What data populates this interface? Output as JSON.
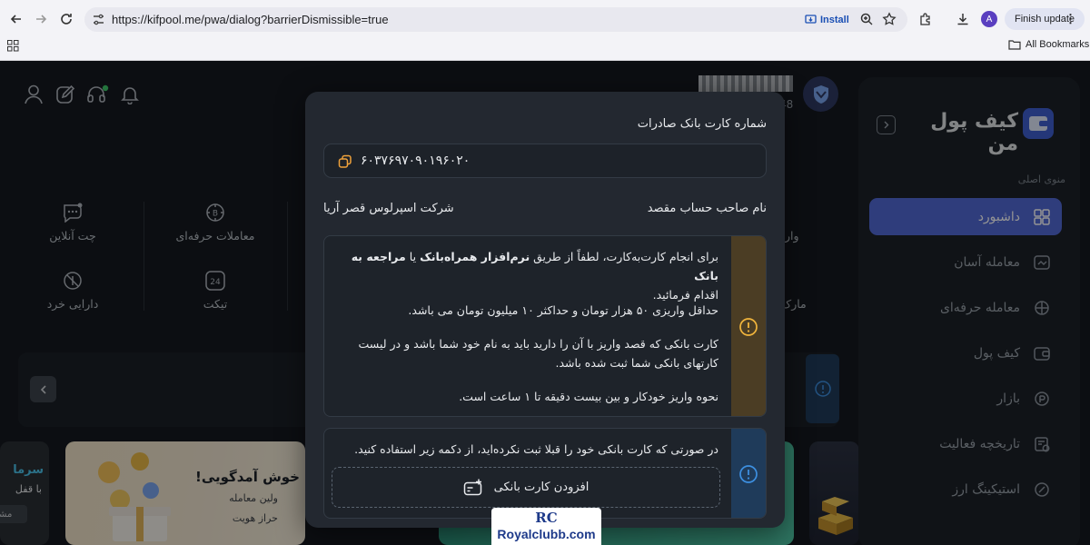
{
  "browser": {
    "url": "https://kifpool.me/pwa/dialog?barrierDismissible=true",
    "install_label": "Install",
    "profile_initial": "A",
    "finish_update_label": "Finish update",
    "bookmarks_label": "All Bookmarks"
  },
  "header": {
    "masked_name_suffix": "48"
  },
  "app": {
    "logo_text": "کیف پول من",
    "menu_heading": "منوی اصلی",
    "nav": [
      {
        "label": "داشبورد",
        "icon": "dashboard-icon",
        "active": true
      },
      {
        "label": "معامله آسان",
        "icon": "easy-trade-icon",
        "active": false
      },
      {
        "label": "معامله حرفه‌ای",
        "icon": "pro-trade-icon",
        "active": false
      },
      {
        "label": "کیف پول",
        "icon": "wallet-icon",
        "active": false
      },
      {
        "label": "بازار",
        "icon": "market-icon",
        "active": false
      },
      {
        "label": "تاریخچه فعالیت",
        "icon": "history-icon",
        "active": false
      },
      {
        "label": "استیکینگ ارز",
        "icon": "staking-icon",
        "active": false
      }
    ],
    "actions": {
      "chat": "چت آنلاین",
      "pro_trades": "معاملات حرفه‌ای",
      "assets": "دارایی خرد",
      "ticket": "تیکت",
      "partial_left_1": "وار",
      "partial_left_2": "مارک"
    },
    "banner_welcome": {
      "title": "خوش آمدگویی!",
      "line1": "ولین معامله",
      "line2": "حراز هویت"
    },
    "banner_left": {
      "title": "سرما",
      "line1": "با قفل",
      "button": "مشا"
    }
  },
  "dialog": {
    "card_title": "شماره کارت بانک صادرات",
    "card_number": "۶۰۳۷۶۹۷۰۹۰۱۹۶۰۲۰",
    "owner_label": "نام صاحب حساب مقصد",
    "owner_value": "شرکت اسپرلوس قصر آریا",
    "warning": {
      "p1_lead": "برای انجام کارت‌به‌کارت، لطفاً از طریق",
      "p1_bold1": "نرم‌افزار همراه‌بانک",
      "p1_mid": "یا",
      "p1_bold2": "مراجعه به بانک",
      "p1_tail": "اقدام فرمائید.",
      "p2": "حداقل واریزی ۵۰ هزار تومان و حداکثر ۱۰ میلیون تومان می باشد.",
      "p3": "کارت بانکی که قصد واریز با آن را دارید باید به نام خود شما باشد و در لیست کارتهای بانکی شما ثبت شده باشد.",
      "p4": "نحوه واریز خودکار و بین بیست دقیقه تا ۱ ساعت است."
    },
    "info": {
      "text": "در صورتی که کارت بانکی خود را قبلا ثبت نکرده‌اید، از دکمه زیر استفاده کنید.",
      "add_card_label": "افزودن کارت بانکی"
    }
  },
  "watermark": {
    "logo": "RC",
    "text": "Royalclubb.com"
  },
  "colors": {
    "accent": "#5269d6",
    "warning": "#f0b43c",
    "info": "#3d8fe0",
    "copy_icon": "#f0a23a"
  }
}
